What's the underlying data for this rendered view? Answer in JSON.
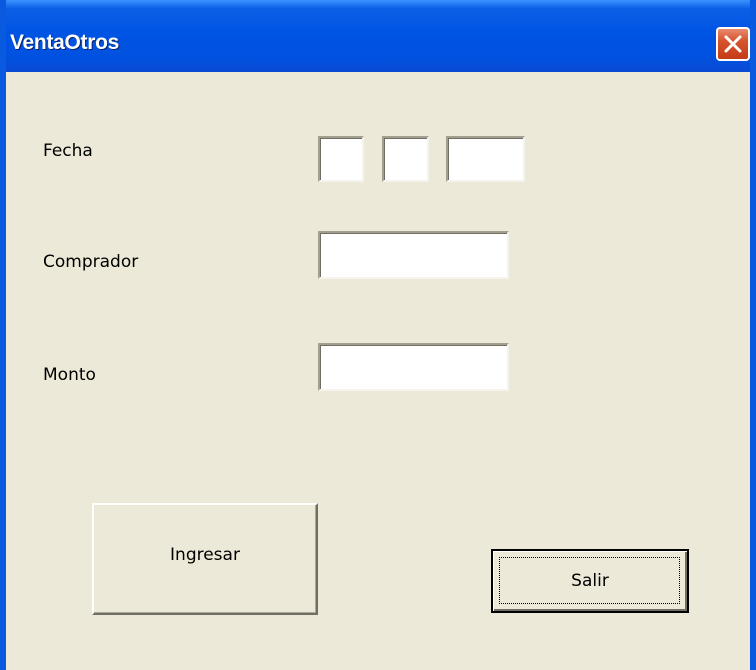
{
  "window": {
    "title": "VentaOtros",
    "close_icon": "close-icon"
  },
  "form": {
    "fecha_label": "Fecha",
    "comprador_label": "Comprador",
    "monto_label": "Monto",
    "fecha_day_value": "",
    "fecha_month_value": "",
    "fecha_year_value": "",
    "comprador_value": "",
    "monto_value": ""
  },
  "buttons": {
    "ingresar_label": "Ingresar",
    "salir_label": "Salir"
  },
  "colors": {
    "titlebar": "#0054e3",
    "client_background": "#ece9d8",
    "close_button": "#d6542e"
  }
}
